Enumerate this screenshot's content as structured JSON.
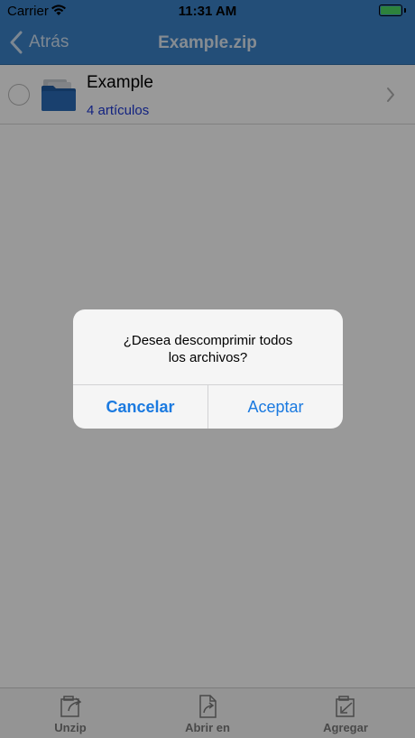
{
  "status": {
    "carrier": "Carrier",
    "time": "11:31 AM"
  },
  "nav": {
    "back_label": "Atrás",
    "title": "Example.zip"
  },
  "list": {
    "items": [
      {
        "name": "Example",
        "subtitle": "4 artículos"
      }
    ]
  },
  "toolbar": {
    "items": [
      {
        "label": "Unzip",
        "icon": "unzip-icon"
      },
      {
        "label": "Abrir en",
        "icon": "open-in-icon"
      },
      {
        "label": "Agregar",
        "icon": "add-icon"
      }
    ]
  },
  "alert": {
    "message_line1": "¿Desea descomprimir todos",
    "message_line2": "los archivos?",
    "cancel_label": "Cancelar",
    "ok_label": "Aceptar"
  },
  "colors": {
    "accent": "#1b7ae0",
    "nav_bg": "#3b82c9",
    "battery": "#4cd964",
    "subtitle": "#1f3ad6"
  }
}
